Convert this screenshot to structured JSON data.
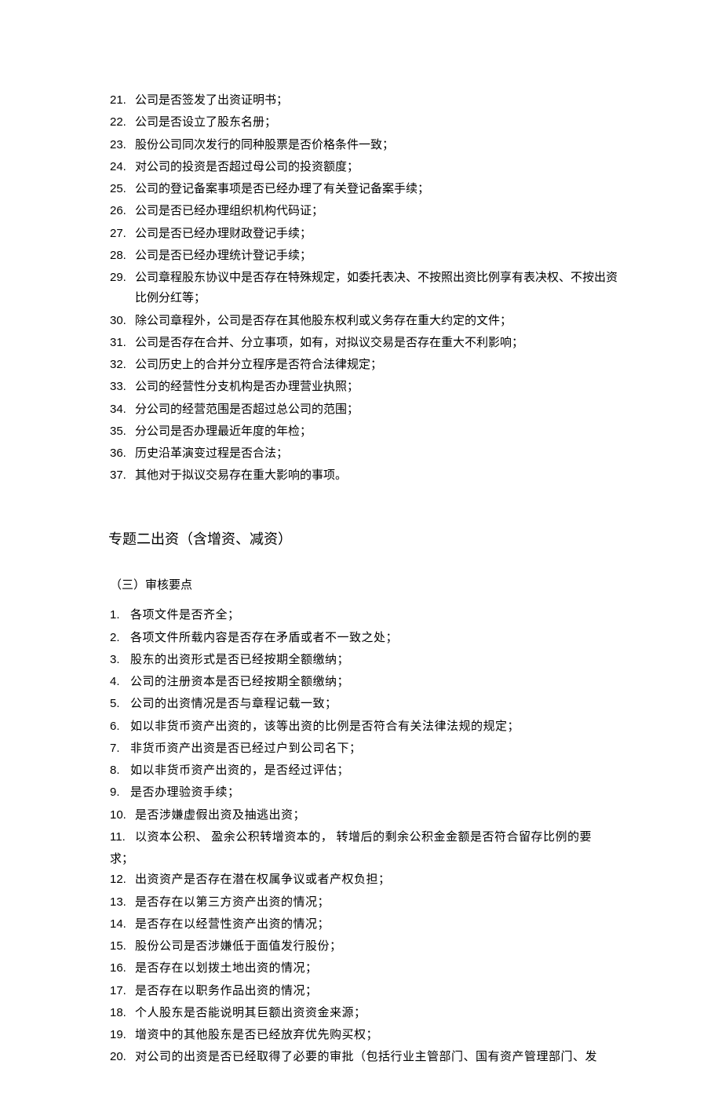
{
  "list1": [
    {
      "num": "21.",
      "text": "公司是否签发了出资证明书；"
    },
    {
      "num": "22.",
      "text": "公司是否设立了股东名册；"
    },
    {
      "num": "23.",
      "text": "股份公司同次发行的同种股票是否价格条件一致；"
    },
    {
      "num": "24.",
      "text": "对公司的投资是否超过母公司的投资额度；"
    },
    {
      "num": "25.",
      "text": "公司的登记备案事项是否已经办理了有关登记备案手续；"
    },
    {
      "num": "26.",
      "text": "公司是否已经办理组织机构代码证；"
    },
    {
      "num": "27.",
      "text": "公司是否已经办理财政登记手续；"
    },
    {
      "num": "28.",
      "text": "公司是否已经办理统计登记手续；"
    },
    {
      "num": "29.",
      "text": "公司章程股东协议中是否存在特殊规定，如委托表决、不按照出资比例享有表决权、不按出资比例分红等；"
    },
    {
      "num": "30.",
      "text": "除公司章程外，公司是否存在其他股东权利或义务存在重大约定的文件；"
    },
    {
      "num": "31.",
      "text": "公司是否存在合并、分立事项，如有，对拟议交易是否存在重大不利影响；"
    },
    {
      "num": "32.",
      "text": "公司历史上的合并分立程序是否符合法律规定；"
    },
    {
      "num": "33.",
      "text": "公司的经营性分支机构是否办理营业执照；"
    },
    {
      "num": "34.",
      "text": "分公司的经营范围是否超过总公司的范围；"
    },
    {
      "num": "35.",
      "text": "分公司是否办理最近年度的年检；"
    },
    {
      "num": "36.",
      "text": "历史沿革演变过程是否合法；"
    },
    {
      "num": "37.",
      "text": "其他对于拟议交易存在重大影响的事项。"
    }
  ],
  "heading2": "专题二出资（含增资、减资）",
  "subheading2": "（三）审核要点",
  "list2": [
    {
      "num": "1.",
      "text": "各项文件是否齐全；"
    },
    {
      "num": "2.",
      "text": "各项文件所载内容是否存在矛盾或者不一致之处；"
    },
    {
      "num": "3.",
      "text": "股东的出资形式是否已经按期全额缴纳；"
    },
    {
      "num": "4.",
      "text": "公司的注册资本是否已经按期全额缴纳；"
    },
    {
      "num": "5.",
      "text": "公司的出资情况是否与章程记载一致；"
    },
    {
      "num": "6.",
      "text": "如以非货币资产出资的，该等出资的比例是否符合有关法律法规的规定；"
    },
    {
      "num": "7.",
      "text": "非货币资产出资是否已经过户到公司名下；"
    },
    {
      "num": "8.",
      "text": "如以非货币资产出资的，是否经过评估；"
    },
    {
      "num": "9.",
      "text": "是否办理验资手续；"
    },
    {
      "num": "10.",
      "text": "是否涉嫌虚假出资及抽逃出资；"
    },
    {
      "num": "11.",
      "text": "以资本公积、 盈余公积转增资本的， 转增后的剩余公积金金额是否符合留存比例的要求；",
      "hanging": true
    },
    {
      "num": "12.",
      "text": "出资资产是否存在潜在权属争议或者产权负担；"
    },
    {
      "num": "13.",
      "text": "是否存在以第三方资产出资的情况；"
    },
    {
      "num": "14.",
      "text": "是否存在以经营性资产出资的情况；"
    },
    {
      "num": "15.",
      "text": "股份公司是否涉嫌低于面值发行股份；"
    },
    {
      "num": "16.",
      "text": "是否存在以划拨土地出资的情况；"
    },
    {
      "num": "17.",
      "text": "是否存在以职务作品出资的情况；"
    },
    {
      "num": "18.",
      "text": "个人股东是否能说明其巨额出资资金来源；"
    },
    {
      "num": "19.",
      "text": "增资中的其他股东是否已经放弃优先购买权；"
    },
    {
      "num": "20.",
      "text": "对公司的出资是否已经取得了必要的审批（包括行业主管部门、国有资产管理部门、发"
    }
  ]
}
